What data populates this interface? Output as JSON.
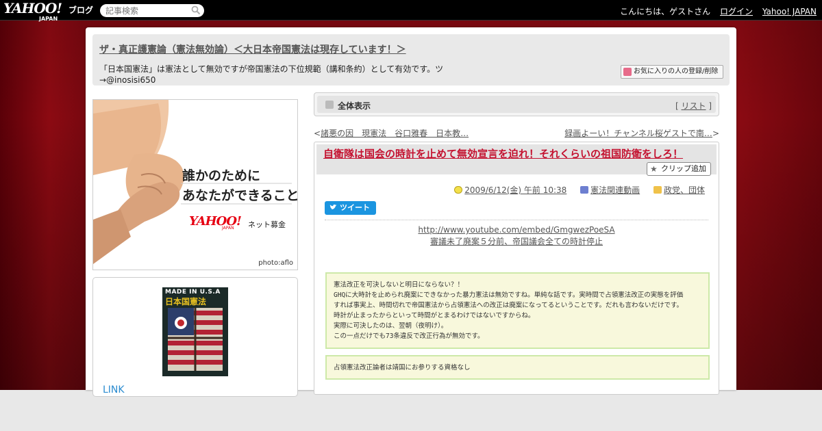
{
  "topbar": {
    "logo": "YAHOO!",
    "logo_sub": "JAPAN",
    "service": "ブログ",
    "search_placeholder": "記事検索",
    "greeting": "こんにちは、ゲストさん",
    "login": "ログイン",
    "yahoo_japan": "Yahoo! JAPAN"
  },
  "header": {
    "blog_title": "ザ・真正護憲論（憲法無効論）＜大日本帝国憲法は現存しています！＞",
    "description": "「日本国憲法」は憲法として無効ですが帝国憲法の下位規範（講和条約）として有効です。ツ→@inosisi650",
    "fav_button": "お気に入りの人の登録/削除"
  },
  "ad": {
    "line1": "誰かのために",
    "line2": "あなたができること",
    "brand": "YAHOO!",
    "brand_sub": "JAPAN",
    "service": "ネット募金",
    "credit": "photo:aflo"
  },
  "side": {
    "book_top": "MADE IN U.S.A",
    "book_title": "日本国憲法",
    "link": "LINK"
  },
  "nav": {
    "label": "全体表示",
    "list_open": "[ ",
    "list": "リスト",
    "list_close": " ]"
  },
  "pager": {
    "prev_mark": "<",
    "prev": "諸悪の因　現憲法　谷口雅春　日本教…",
    "next": "録画よーい！チャンネル桜ゲストで南…",
    "next_mark": ">"
  },
  "article": {
    "title": "自衛隊は国会の時計を止めて無効宣言を迫れ！それくらいの祖国防衛をしろ！",
    "clip_button": "クリップ追加",
    "date": "2009/6/12(金) 午前 10:38",
    "category": "憲法関連動画",
    "folder": "政党、団体",
    "tweet": "ツイート",
    "video_url": "http://www.youtube.com/embed/GmgwezPoeSA",
    "video_caption": "審議未了廃案５分前、帝国議会全ての時計停止",
    "note1": [
      "憲法改正を可決しないと明日にならない？！",
      "GHQに大時計を止められ廃案にできなかった暴力憲法は無効ですね。単純な話です。実時間で占領憲法改正の実態を評価",
      "すれば事実上、時間切れで帝国憲法から占領憲法への改正は廃案になってるということです。だれも言わないだけです。",
      "時計が止まったからといって時間がとまるわけではないですからね。",
      "実際に可決したのは、翌朝（夜明け）。",
      "この一点だけでも73条違反で改正行為が無効です。"
    ],
    "note2": "占領憲法改正論者は靖国にお参りする資格なし"
  },
  "colors": {
    "background_red": "#8c0a12",
    "title_red": "#c41230",
    "tweet_blue": "#1b95e0",
    "note_bg": "#f8f8dc",
    "note_border": "#cde9a8"
  }
}
